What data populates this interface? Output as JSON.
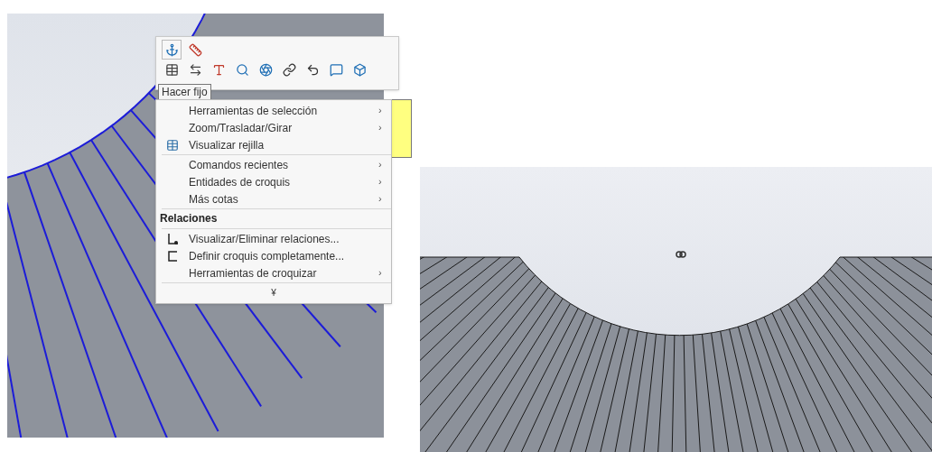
{
  "tooltip": {
    "text": "Hacer fijo"
  },
  "menu": {
    "items": [
      {
        "kind": "submenu",
        "label": "Herramientas de selección",
        "arrow": "›"
      },
      {
        "kind": "submenu",
        "label": "Zoom/Trasladar/Girar",
        "arrow": "›"
      },
      {
        "kind": "grid",
        "label": "Visualizar rejilla"
      },
      {
        "kind": "separator"
      },
      {
        "kind": "submenu",
        "label": "Comandos recientes",
        "arrow": "›"
      },
      {
        "kind": "submenu",
        "label": "Entidades de croquis",
        "arrow": "›"
      },
      {
        "kind": "submenu",
        "label": "Más cotas",
        "arrow": "›"
      },
      {
        "kind": "separator"
      },
      {
        "kind": "header",
        "label": "Relaciones"
      },
      {
        "kind": "separator"
      },
      {
        "kind": "relations",
        "label": "Visualizar/Eliminar relaciones..."
      },
      {
        "kind": "define",
        "label": "Definir croquis completamente..."
      },
      {
        "kind": "submenu",
        "label": "Herramientas de croquizar",
        "arrow": "›"
      },
      {
        "kind": "separator"
      },
      {
        "kind": "expand",
        "label": "¥"
      }
    ]
  }
}
